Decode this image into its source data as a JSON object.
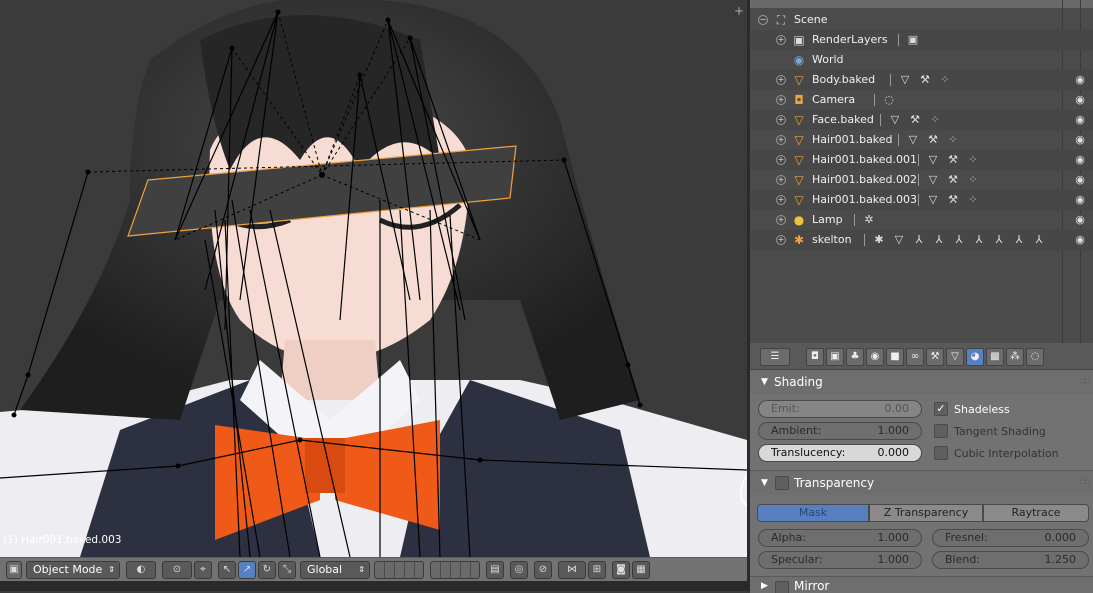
{
  "viewport": {
    "object_info": "(1) Hair001.baked.003",
    "add_icon": "+"
  },
  "header3d": {
    "mode": "Object Mode",
    "orientation": "Global"
  },
  "outliner": {
    "items": [
      {
        "label": "Scene",
        "icon": "scene-icon",
        "glyph": "⛶",
        "color": "#c8c8c8"
      },
      {
        "label": "RenderLayers",
        "icon": "renderlayers-icon",
        "glyph": "▣",
        "color": "#dcdcdc"
      },
      {
        "label": "World",
        "icon": "world-icon",
        "glyph": "◉",
        "color": "#7aa7d8"
      },
      {
        "label": "Body.baked",
        "icon": "mesh-icon",
        "glyph": "▽",
        "color": "#f0a040"
      },
      {
        "label": "Camera",
        "icon": "camera-icon",
        "glyph": "◘",
        "color": "#f0a040"
      },
      {
        "label": "Face.baked",
        "icon": "mesh-icon",
        "glyph": "▽",
        "color": "#f0a040"
      },
      {
        "label": "Hair001.baked",
        "icon": "mesh-icon",
        "glyph": "▽",
        "color": "#f0a040"
      },
      {
        "label": "Hair001.baked.001",
        "icon": "mesh-icon",
        "glyph": "▽",
        "color": "#f0a040"
      },
      {
        "label": "Hair001.baked.002",
        "icon": "mesh-icon",
        "glyph": "▽",
        "color": "#f0a040"
      },
      {
        "label": "Hair001.baked.003",
        "icon": "mesh-icon",
        "glyph": "▽",
        "color": "#f0a040"
      },
      {
        "label": "Lamp",
        "icon": "lamp-icon",
        "glyph": "●",
        "color": "#f0c040"
      },
      {
        "label": "skelton",
        "icon": "armature-icon",
        "glyph": "✱",
        "color": "#f0a040"
      }
    ]
  },
  "props": {
    "shading": {
      "title": "Shading",
      "emit": {
        "label": "Emit:",
        "value": "0.00"
      },
      "ambient": {
        "label": "Ambient:",
        "value": "1.000"
      },
      "translucency": {
        "label": "Translucency:",
        "value": "0.000"
      },
      "shadeless": "Shadeless",
      "tangent": "Tangent Shading",
      "cubic": "Cubic Interpolation"
    },
    "transparency": {
      "title": "Transparency",
      "modes": [
        "Mask",
        "Z Transparency",
        "Raytrace"
      ],
      "alpha": {
        "label": "Alpha:",
        "value": "1.000"
      },
      "fresnel": {
        "label": "Fresnel:",
        "value": "0.000"
      },
      "specular": {
        "label": "Specular:",
        "value": "1.000"
      },
      "blend": {
        "label": "Blend:",
        "value": "1.250"
      }
    },
    "mirror": {
      "title": "Mirror"
    }
  },
  "colors": {
    "accent": "#5680c2",
    "selection_outline": "#f0a040"
  }
}
